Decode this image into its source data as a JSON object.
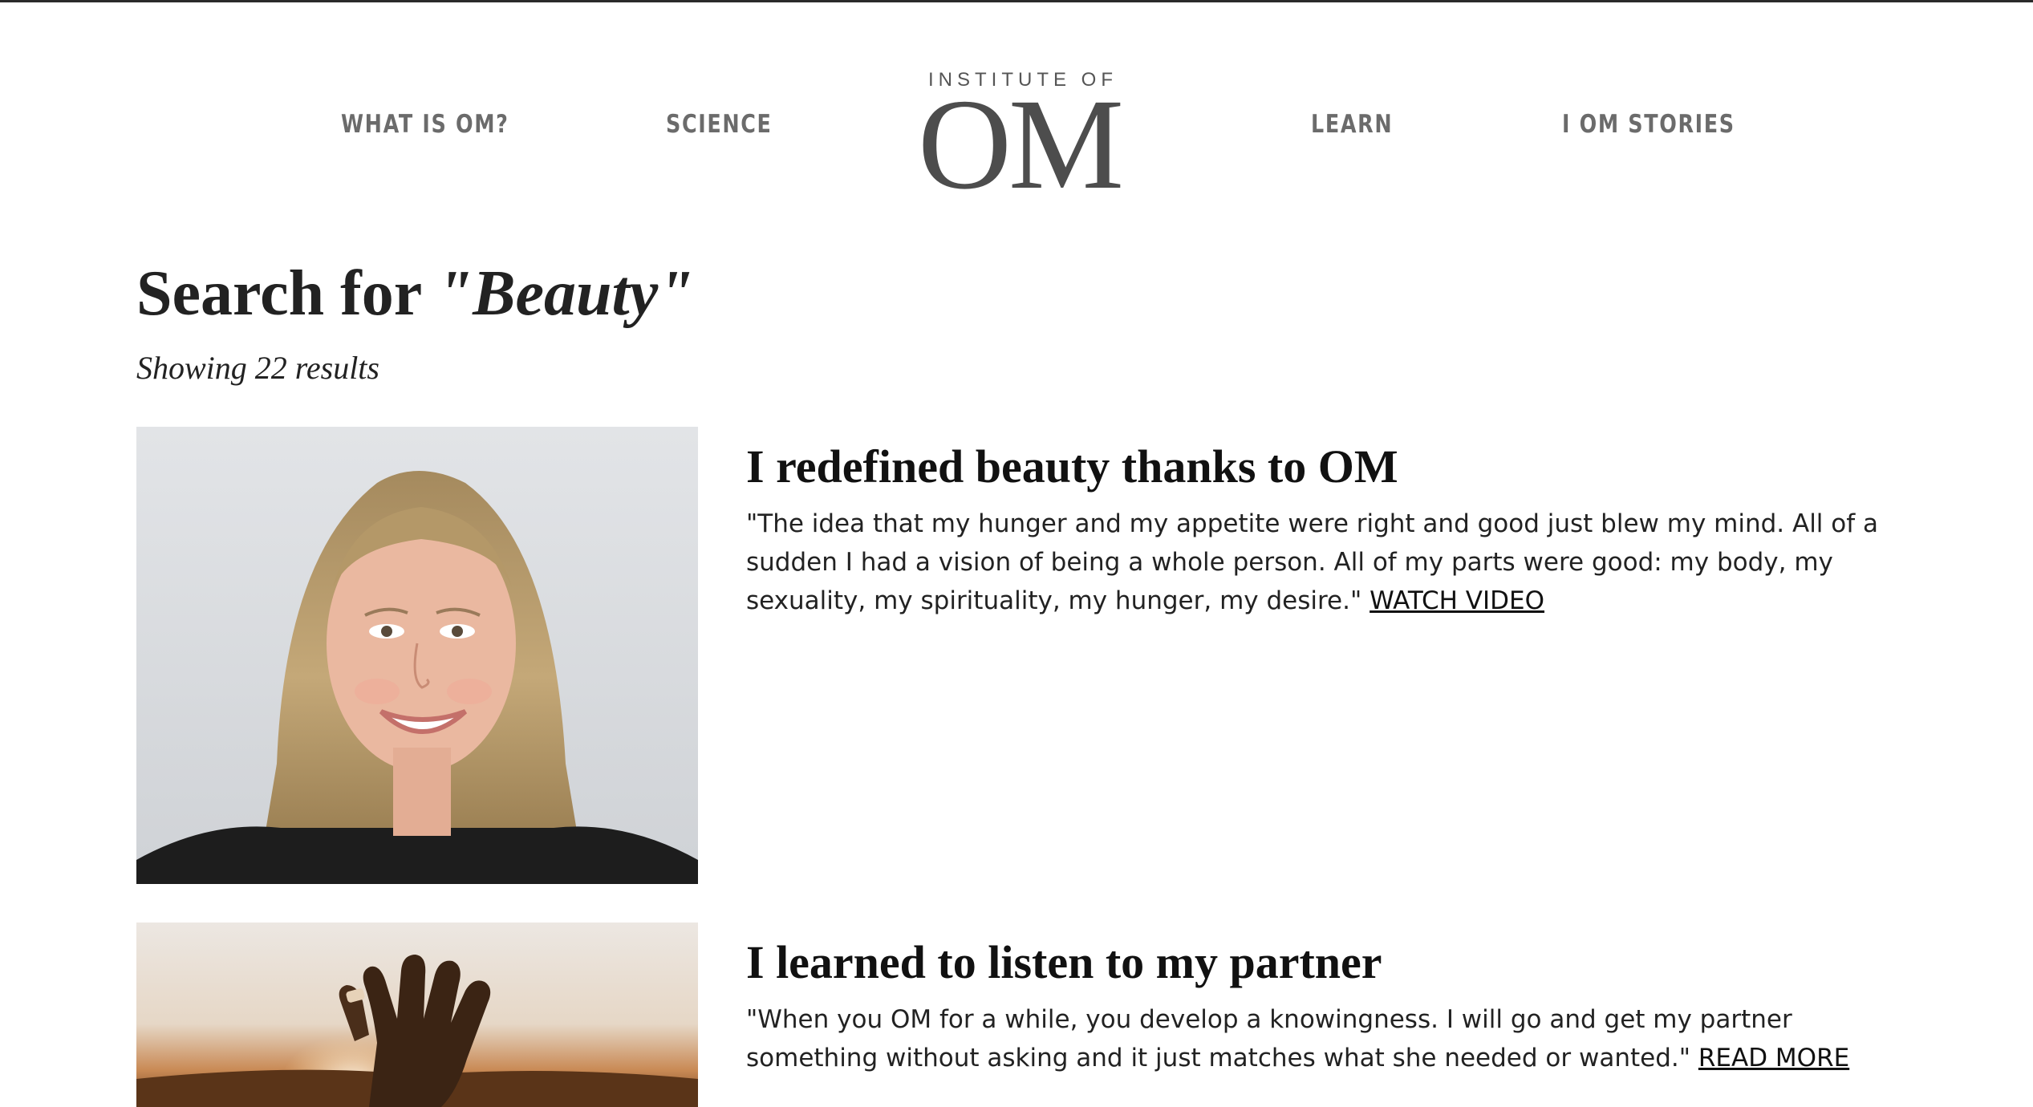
{
  "nav": {
    "items": [
      {
        "label": "WHAT IS OM?"
      },
      {
        "label": "SCIENCE"
      },
      {
        "label": "LEARN"
      },
      {
        "label": "I OM STORIES"
      }
    ],
    "logo": {
      "top_line": "INSTITUTE OF",
      "main": "OM"
    }
  },
  "search": {
    "prefix": "Search for",
    "query": "\"Beauty\"",
    "count_text": "Showing 22 results"
  },
  "results": [
    {
      "title": "I redefined beauty thanks to OM",
      "excerpt": "\"The idea that my hunger and my appetite were right and good just blew my mind. All of a sudden I had a vision of being a whole person. All of my parts were good: my body, my sexuality, my spirituality, my hunger, my desire.\"",
      "link_label": "WATCH VIDEO"
    },
    {
      "title": "I learned to listen to my partner",
      "excerpt": "\"When you OM for a while, you develop a knowingness. I will go and get my partner something without asking and it just matches what she needed or wanted.\"",
      "link_label": "READ MORE"
    }
  ]
}
